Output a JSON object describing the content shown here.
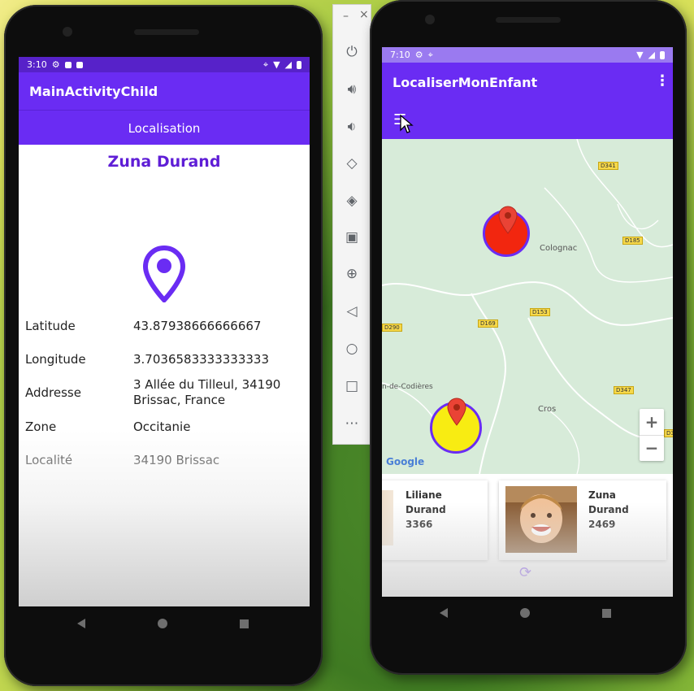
{
  "left_app": {
    "status_time": "3:10",
    "title": "MainActivityChild",
    "tab_label": "Localisation",
    "child_name": "Zuna Durand",
    "fields": [
      {
        "label": "Latitude",
        "value": "43.87938666666667"
      },
      {
        "label": "Longitude",
        "value": "3.7036583333333333"
      },
      {
        "label": "Addresse",
        "value_line1": "3 Allée du Tilleul, 34190",
        "value_line2": "Brissac, France"
      },
      {
        "label": "Zone",
        "value": "Occitanie"
      },
      {
        "label": "Localité",
        "value": "34190 Brissac"
      }
    ],
    "accent_color": "#6a2cf3"
  },
  "emulator_toolbar": {
    "items": [
      "power-icon",
      "volume-up-icon",
      "volume-down-icon",
      "rotate-left-icon",
      "rotate-right-icon",
      "camera-icon",
      "zoom-icon",
      "back-icon",
      "home-icon",
      "overview-icon",
      "more-icon"
    ],
    "minimize_label": "–",
    "close_label": "×"
  },
  "right_app": {
    "status_time": "7:10",
    "title": "LocaliserMonEnfant",
    "map": {
      "places": [
        "Colognac",
        "Cros",
        "n-de-Codières"
      ],
      "road_labels": [
        "D341",
        "D185",
        "D153",
        "D169",
        "D290",
        "D347",
        "D3"
      ],
      "attribution": "Google",
      "zoom_in": "+",
      "zoom_out": "−",
      "markers": [
        {
          "color": "#f2260f"
        },
        {
          "color": "#f8ec12"
        }
      ]
    },
    "children": [
      {
        "first": "Liliane",
        "last": "Durand",
        "code": "3366"
      },
      {
        "first": "Zuna",
        "last": "Durand",
        "code": "2469"
      }
    ]
  }
}
